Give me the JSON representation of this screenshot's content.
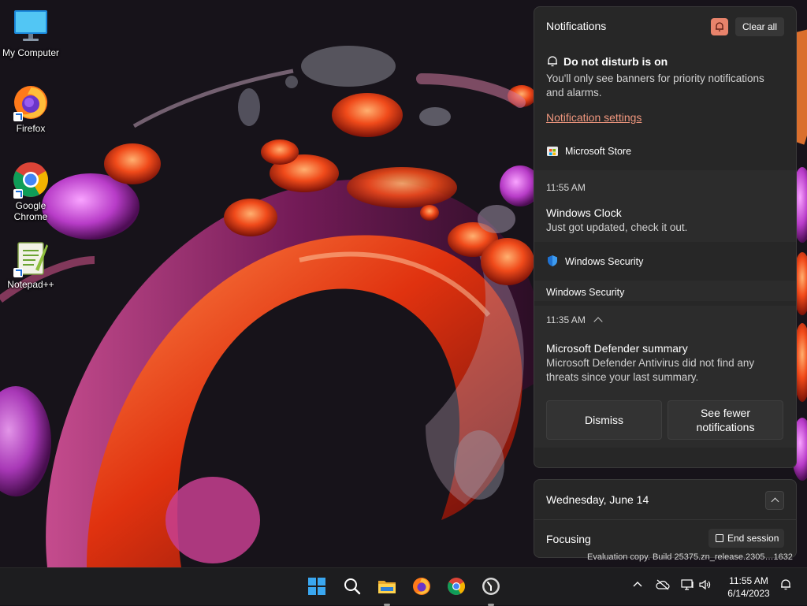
{
  "desktop": {
    "icons": [
      {
        "label": "My Computer",
        "icon": "monitor-icon"
      },
      {
        "label": "Firefox",
        "icon": "firefox-icon"
      },
      {
        "label": "Google Chrome",
        "icon": "chrome-icon"
      },
      {
        "label": "Notepad++",
        "icon": "notepadpp-icon"
      }
    ]
  },
  "notifications": {
    "title": "Notifications",
    "clear_all": "Clear all",
    "dnd": {
      "title": "Do not disturb is on",
      "body": "You'll only see banners for priority notifications and alarms."
    },
    "settings_link": "Notification settings",
    "apps": [
      {
        "name": "Microsoft Store",
        "cards": [
          {
            "time": "11:55 AM",
            "title": "Windows Clock",
            "body": "Just got updated, check it out."
          }
        ]
      },
      {
        "name": "Windows Security",
        "group_header": "Windows Security",
        "cards": [
          {
            "time": "11:35 AM",
            "title": "Microsoft Defender summary",
            "body": "Microsoft Defender Antivirus did not find any threats since your last summary.",
            "actions": [
              "Dismiss",
              "See fewer notifications"
            ]
          }
        ]
      }
    ]
  },
  "calendar": {
    "date": "Wednesday, June 14",
    "focus_label": "Focusing",
    "end_session": "End session"
  },
  "watermark": "Evaluation copy. Build 25375.zn_release.2305…1632",
  "taskbar": {
    "apps": [
      "start-icon",
      "search-icon",
      "file-explorer-icon",
      "firefox-icon",
      "chrome-icon",
      "clock-app-icon"
    ],
    "clock": {
      "time": "11:55 AM",
      "date": "6/14/2023"
    }
  },
  "colors": {
    "accent_link": "#f0977e",
    "focus_badge": "#e8836b",
    "panel_bg": "#272727",
    "taskbar_bg": "#1d1d1f"
  }
}
